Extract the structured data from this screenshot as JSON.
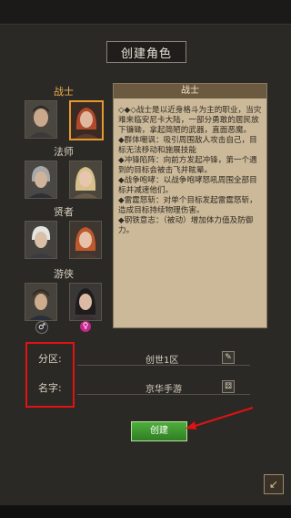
{
  "title": "创建角色",
  "classes": [
    {
      "label": "战士",
      "active": true
    },
    {
      "label": "法师",
      "active": false
    },
    {
      "label": "贤者",
      "active": false
    },
    {
      "label": "游侠",
      "active": false
    }
  ],
  "description": {
    "header": "战士",
    "text": "◇◆◇战士是以近身格斗为主的职业，当灾难来临安尼卡大陆，一部分勇敢的居民放下镰锄，拿起简陋的武器，直面恶魔。\n◆群体嘲讽：吸引周围敌人攻击自己，目标无法移动和施展技能\n◆冲锋陷阵：向前方发起冲锋，第一个遇到的目标会被击飞并眩晕。\n◆战争咆哮：以战争咆哮怒吼周围全部目标并减速他们。\n◆雷霆怒斩：对单个目标发起雷霆怒斩，造成目标持续物理伤害。\n◆钢铁意志：（被动）增加体力值及防御力。"
  },
  "form": {
    "server_label": "分区:",
    "server_value": "创世1区",
    "name_label": "名字:",
    "name_value": "京华手游"
  },
  "create_button": "创建",
  "gender": {
    "male": "♂",
    "female": "♀"
  },
  "colors": {
    "accent": "#e59a2e",
    "button": "#3c962f",
    "highlight": "#e01212"
  }
}
